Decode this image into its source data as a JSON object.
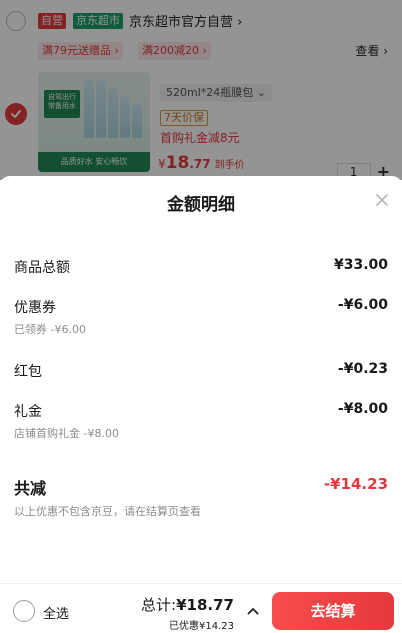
{
  "cart": {
    "shop": {
      "tag_self": "自营",
      "tag_brand": "京东超市",
      "name": "京东超市官方自营 ›"
    },
    "promos": [
      "满79元送赠品 ›",
      "满200减20 ›"
    ],
    "view_label": "查看 ›",
    "product": {
      "image_badge": "自驾出行 常备用水",
      "image_caption": "品质好水 安心畅饮",
      "spec": "520ml*24瓶膜包 ⌄",
      "guarantee": "7天价保",
      "coupon": "首购礼金减8元",
      "price_currency": "¥",
      "price_int": "18",
      "price_dec": ".77",
      "price_note": "到手价",
      "quantity": "1",
      "plus": "+"
    }
  },
  "sheet": {
    "title": "金额明细",
    "rows": [
      {
        "label": "商品总额",
        "amount": "¥33.00",
        "sub": ""
      },
      {
        "label": "优惠券",
        "amount": "-¥6.00",
        "sub": "已领券 -¥6.00"
      },
      {
        "label": "红包",
        "amount": "-¥0.23",
        "sub": ""
      },
      {
        "label": "礼金",
        "amount": "-¥8.00",
        "sub": "店铺首购礼金 -¥8.00"
      }
    ],
    "total": {
      "label": "共减",
      "amount": "-¥14.23",
      "note": "以上优惠不包含京豆，请在结算页查看"
    }
  },
  "bottom": {
    "select_all": "全选",
    "total_label": "总计:",
    "total_value": "¥18.77",
    "saved": "已优惠¥14.23",
    "checkout": "去结算"
  },
  "colors": {
    "accent": "#e4393c",
    "brand_green": "#18a06a"
  }
}
